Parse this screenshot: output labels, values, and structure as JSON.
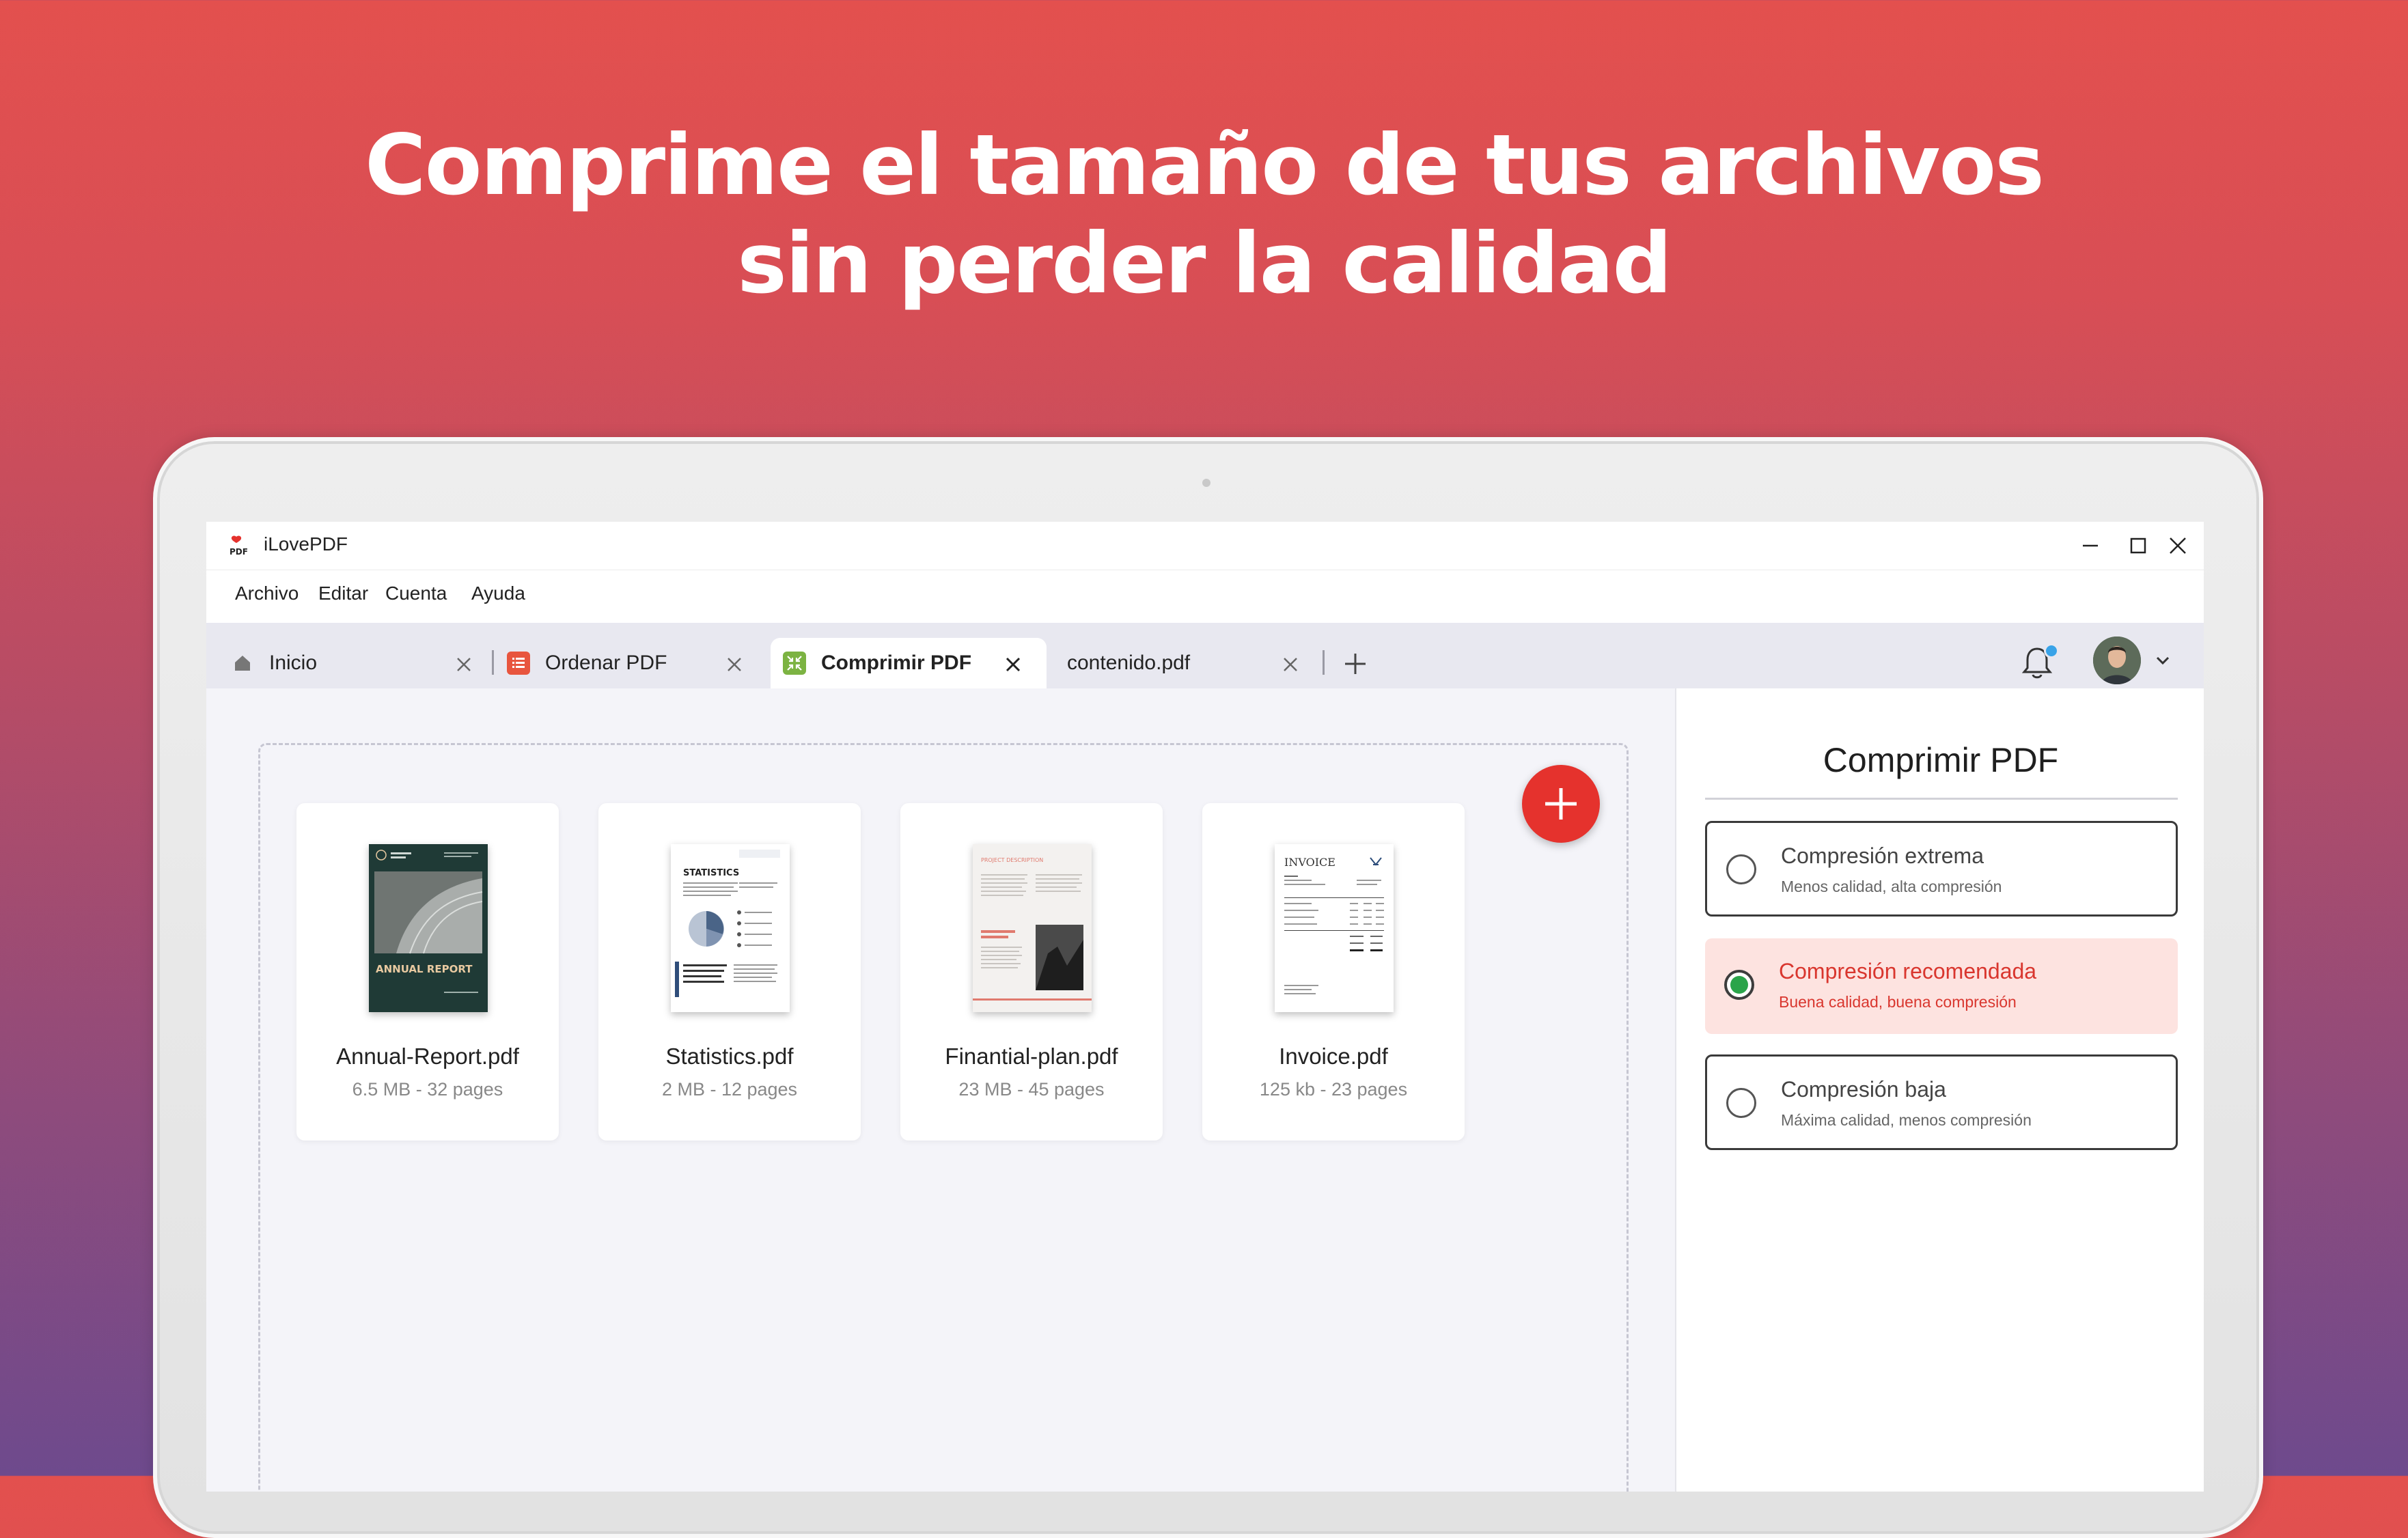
{
  "headline": {
    "line1": "Comprime el tamaño de tus archivos",
    "line2": "sin perder la calidad"
  },
  "window": {
    "title": "iLovePDF",
    "logo_text": "PDF"
  },
  "menu": [
    "Archivo",
    "Editar",
    "Cuenta",
    "Ayuda"
  ],
  "tabs": [
    {
      "label": "Inicio",
      "icon": "home-icon"
    },
    {
      "label": "Ordenar PDF",
      "icon": "organize-pdf-icon"
    },
    {
      "label": "Comprimir PDF",
      "icon": "compress-pdf-icon",
      "active": true
    },
    {
      "label": "contenido.pdf",
      "icon": ""
    }
  ],
  "files": [
    {
      "name": "Annual-Report.pdf",
      "meta": "6.5 MB - 32 pages",
      "thumb_title": "ANNUAL REPORT"
    },
    {
      "name": "Statistics.pdf",
      "meta": "2 MB - 12 pages",
      "thumb_title": "STATISTICS"
    },
    {
      "name": "Finantial-plan.pdf",
      "meta": "23 MB - 45 pages",
      "thumb_title": "PROJECT DESCRIPTION"
    },
    {
      "name": "Invoice.pdf",
      "meta": "125 kb - 23 pages",
      "thumb_title": "INVOICE"
    }
  ],
  "panel": {
    "title": "Comprimir PDF",
    "options": [
      {
        "title": "Compresión extrema",
        "subtitle": "Menos calidad, alta compresión",
        "selected": false
      },
      {
        "title": "Compresión recomendada",
        "subtitle": "Buena calidad, buena compresión",
        "selected": true
      },
      {
        "title": "Compresión baja",
        "subtitle": "Máxima calidad, menos compresión",
        "selected": false
      }
    ]
  },
  "colors": {
    "accent": "#e5322d",
    "selected_bg": "#fde3e0",
    "notification_dot": "#39a3e8",
    "radio_on": "#2aa44a"
  }
}
